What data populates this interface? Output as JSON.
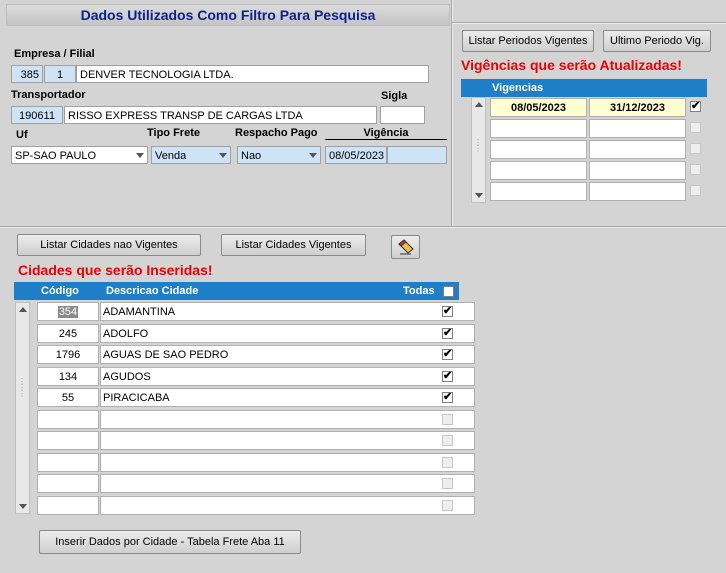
{
  "header": {
    "title": "Dados Utilizados Como Filtro Para Pesquisa"
  },
  "filters": {
    "empresa_label": "Empresa / Filial",
    "empresa_code": "385",
    "filial_code": "1",
    "empresa_name": "DENVER TECNOLOGIA LTDA.",
    "transportador_label": "Transportador",
    "transportador_code": "190611",
    "transportador_name": "RISSO EXPRESS TRANSP DE CARGAS LTDA",
    "sigla_label": "Sigla",
    "sigla_value": "",
    "uf_label": "Uf",
    "uf_value": "SP-SAO PAULO",
    "tipo_frete_label": "Tipo Frete",
    "tipo_frete_value": "Venda",
    "respacho_label": "Respacho Pago",
    "respacho_value": "Nao",
    "vigencia_label": "Vigência",
    "vigencia_value": "08/05/2023"
  },
  "vigencias_panel": {
    "btn_listar": "Listar Periodos Vigentes",
    "btn_ultimo": "Ultimo Periodo Vig.",
    "title": "Vigências que serão Atualizadas!",
    "column": "Vigencias",
    "rows": [
      {
        "start": "08/05/2023",
        "end": "31/12/2023",
        "checked": "✔"
      },
      {
        "start": "",
        "end": "",
        "checked": ""
      },
      {
        "start": "",
        "end": "",
        "checked": ""
      },
      {
        "start": "",
        "end": "",
        "checked": ""
      },
      {
        "start": "",
        "end": "",
        "checked": ""
      }
    ]
  },
  "cidades_panel": {
    "btn_nao_vigentes": "Listar Cidades nao Vigentes",
    "btn_vigentes": "Listar Cidades Vigentes",
    "eraser_icon": "eraser-icon",
    "title": "Cidades que serão Inseridas!",
    "col_codigo": "Código",
    "col_descricao": "Descricao Cidade",
    "col_todas": "Todas",
    "rows": [
      {
        "codigo": "354",
        "descricao": "ADAMANTINA",
        "checked": "✔"
      },
      {
        "codigo": "245",
        "descricao": "ADOLFO",
        "checked": "✔"
      },
      {
        "codigo": "1796",
        "descricao": "AGUAS DE SAO PEDRO",
        "checked": "✔"
      },
      {
        "codigo": "134",
        "descricao": "AGUDOS",
        "checked": "✔"
      },
      {
        "codigo": "55",
        "descricao": "PIRACICABA",
        "checked": "✔"
      },
      {
        "codigo": "",
        "descricao": "",
        "checked": ""
      },
      {
        "codigo": "",
        "descricao": "",
        "checked": ""
      },
      {
        "codigo": "",
        "descricao": "",
        "checked": ""
      },
      {
        "codigo": "",
        "descricao": "",
        "checked": ""
      },
      {
        "codigo": "",
        "descricao": "",
        "checked": ""
      }
    ],
    "btn_inserir": "Inserir Dados por Cidade - Tabela Frete Aba 11"
  }
}
